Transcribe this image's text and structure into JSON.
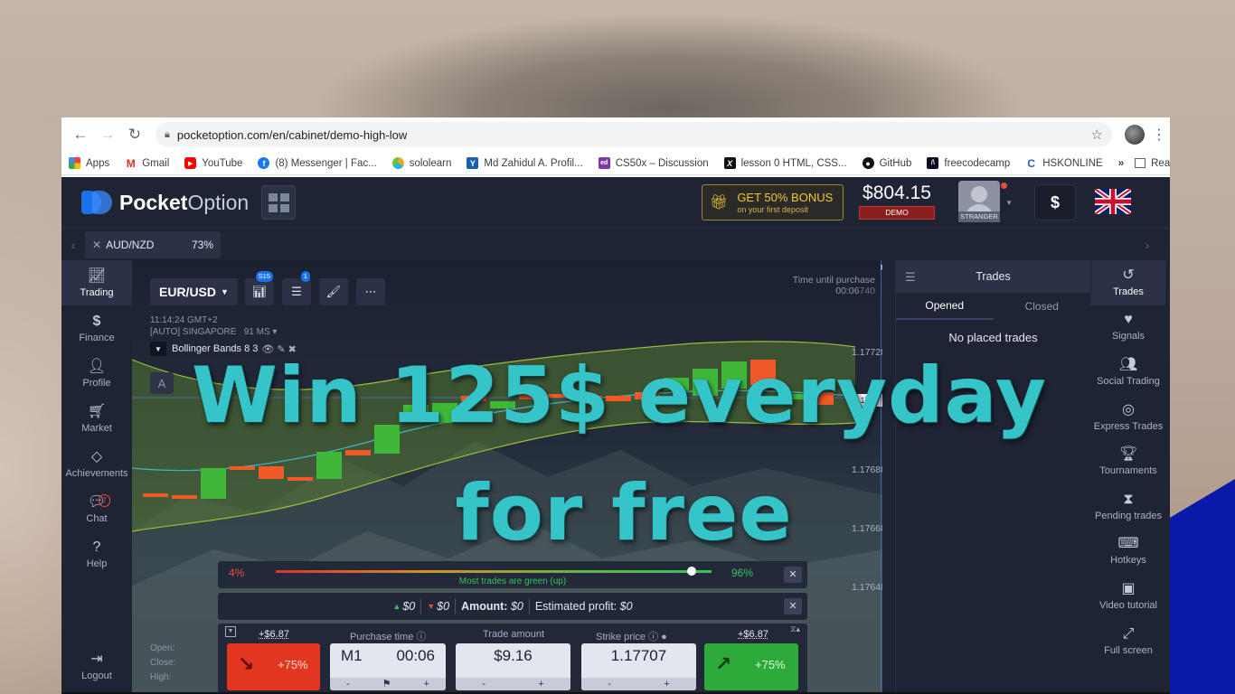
{
  "browser": {
    "url": "pocketoption.com/en/cabinet/demo-high-low",
    "bookmarks": [
      "Apps",
      "Gmail",
      "YouTube",
      "(8) Messenger | Fac...",
      "sololearn",
      "Md Zahidul A. Profil...",
      "CS50x – Discussion",
      "lesson 0 HTML, CSS...",
      "GitHub",
      "freecodecamp",
      "HSKONLINE"
    ],
    "more": "»",
    "reading_list": "Reading list"
  },
  "header": {
    "logo_bold": "Pocket",
    "logo_light": "Option",
    "bonus_line1": "GET 50% BONUS",
    "bonus_line2": "on your first deposit",
    "balance": "$804.15",
    "balance_mode": "DEMO",
    "user_name": "STRANGER",
    "currency_symbol": "$"
  },
  "asset_tab": {
    "name": "AUD/NZD",
    "payout": "73%"
  },
  "left_nav": [
    {
      "label": "Trading",
      "icon": "chart-icon"
    },
    {
      "label": "Finance",
      "icon": "dollar-icon"
    },
    {
      "label": "Profile",
      "icon": "user-icon"
    },
    {
      "label": "Market",
      "icon": "cart-icon"
    },
    {
      "label": "Achievements",
      "icon": "diamond-icon"
    },
    {
      "label": "Chat",
      "icon": "chat-icon",
      "badge": "7"
    },
    {
      "label": "Help",
      "icon": "help-icon"
    }
  ],
  "logout_label": "Logout",
  "right_nav": [
    {
      "label": "Trades",
      "icon": "history-icon"
    },
    {
      "label": "Signals",
      "icon": "heartbeat-icon"
    },
    {
      "label": "Social Trading",
      "icon": "users-icon"
    },
    {
      "label": "Express Trades",
      "icon": "target-icon"
    },
    {
      "label": "Tournaments",
      "icon": "trophy-icon"
    },
    {
      "label": "Pending trades",
      "icon": "hourglass-icon"
    },
    {
      "label": "Hotkeys",
      "icon": "keyboard-icon"
    },
    {
      "label": "Video tutorial",
      "icon": "video-icon"
    },
    {
      "label": "Full screen",
      "icon": "fullscreen-icon"
    }
  ],
  "chart": {
    "pair": "EUR/USD",
    "timeframe_badge": "S15",
    "indicators_badge": "1",
    "time_until_label": "Time until purchase",
    "time_until_value": "00:06",
    "price_overlap": "740",
    "clock": "11:14:24 GMT+2",
    "server": "[AUTO] SINGAPORE",
    "ping": "91 MS",
    "indicator_name": "Bollinger Bands 8 3",
    "a_label": "A",
    "prices": [
      "1.17720",
      "1.17680",
      "1.17660",
      "1.17640"
    ],
    "live_price": "1.177",
    "bottom_labels": [
      "Open:",
      "Close:",
      "High:"
    ]
  },
  "sentiment": {
    "down_pct": "4%",
    "up_pct": "96%",
    "caption": "Most trades are green (up)",
    "level_up": 0.96
  },
  "amount_row": {
    "up_val": "$0",
    "down_val": "$0",
    "amount_label": "Amount:",
    "amount_val": "$0",
    "profit_label": "Estimated profit:",
    "profit_val": "$0"
  },
  "trade_panel": {
    "profit_left": "+$6.87",
    "profit_right": "+$6.87",
    "purchase_time_label": "Purchase time",
    "trade_amount_label": "Trade amount",
    "strike_price_label": "Strike price",
    "timeframe": "M1",
    "time_value": "00:06",
    "amount_value": "$9.16",
    "strike_value": "1.17707",
    "down_pct": "+75%",
    "up_pct": "+75%",
    "minus": "-",
    "plus": "+"
  },
  "trades_panel": {
    "title": "Trades",
    "tab_opened": "Opened",
    "tab_closed": "Closed",
    "empty_text": "No placed trades"
  },
  "overlay": {
    "line1": "Win 125$ everyday",
    "line2": "for free"
  },
  "colors": {
    "app_bg": "#1f2435",
    "overlay_text": "#35c5c8",
    "down": "#e2361f",
    "up": "#2daa3a",
    "bull_candle": "#3fb83a",
    "bear_candle": "#f05a28"
  }
}
